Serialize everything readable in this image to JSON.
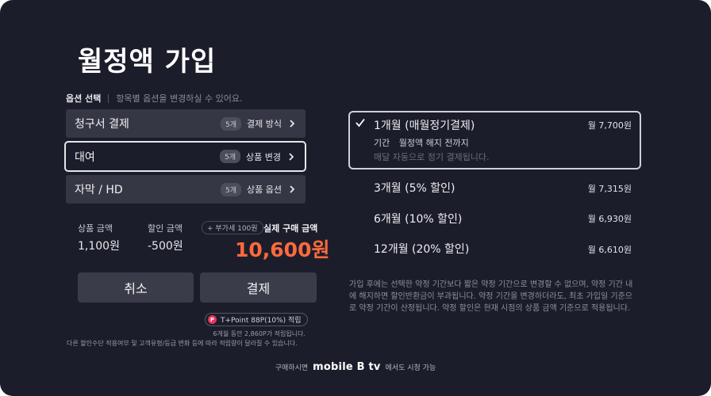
{
  "page": {
    "title": "월정액 가입"
  },
  "options_header": {
    "label": "옵션 선택",
    "hint": "항목별 옵션을 변경하실 수 있어요."
  },
  "options": [
    {
      "label": "청구서 결제",
      "badge": "5개",
      "meta": "결제 방식"
    },
    {
      "label": "대여",
      "badge": "5개",
      "meta": "상품 변경"
    },
    {
      "label": "자막 / HD",
      "badge": "5개",
      "meta": "상품 옵션"
    }
  ],
  "summary": {
    "product_label": "상품 금액",
    "product_value": "1,100원",
    "discount_label": "할인 금액",
    "discount_value": "-500원",
    "vat_chip": "+ 부가세 100원",
    "final_label": "실제 구매 금액",
    "final_value": "10,600원"
  },
  "buttons": {
    "cancel": "취소",
    "pay": "결제"
  },
  "points": {
    "chip_icon": "P",
    "chip_text": "T+Point 88P(10%) 적립",
    "note1": "6개월 동안 2,860P가 적립됩니다.",
    "note2": "다른 할인수단 적용여부 및 고객유형/등급 변화 등에 따라 적립량이 달라질 수 있습니다."
  },
  "plans": [
    {
      "title": "1개월 (매월정기결제)",
      "price": "월 7,700원",
      "selected": true,
      "detail_label": "기간",
      "detail_value": "월정액 해지 전까지",
      "detail_note": "매달 자동으로 정기 결제됩니다."
    },
    {
      "title": "3개월 (5% 할인)",
      "price": "월 7,315원"
    },
    {
      "title": "6개월 (10% 할인)",
      "price": "월 6,930원"
    },
    {
      "title": "12개월 (20% 할인)",
      "price": "월 6,610원"
    }
  ],
  "disclaimer": "가입 후에는 선택한 약정 기간보다 짧은 약정 기간으로 변경할 수 없으며, 약정 기간 내에 해지하면 할인반환금이 부과됩니다. 약정 기간을 변경하더라도, 최초 가입일 기준으로 약정 기간이 산정됩니다. 약정 할인은 현재 시점의 상품 금액 기준으로 적용됩니다.",
  "footer": {
    "prefix": "구매하시면",
    "brand": "mobile B tv",
    "suffix": "에서도 시청 가능"
  },
  "colors": {
    "background": "#1c1d2b",
    "accent_price": "#ff6a3d",
    "row_bg": "#363744",
    "point_badge": "#e8355a"
  },
  "icons": {
    "chevron": "chevron-right-icon",
    "check": "check-icon",
    "point": "point-icon"
  }
}
